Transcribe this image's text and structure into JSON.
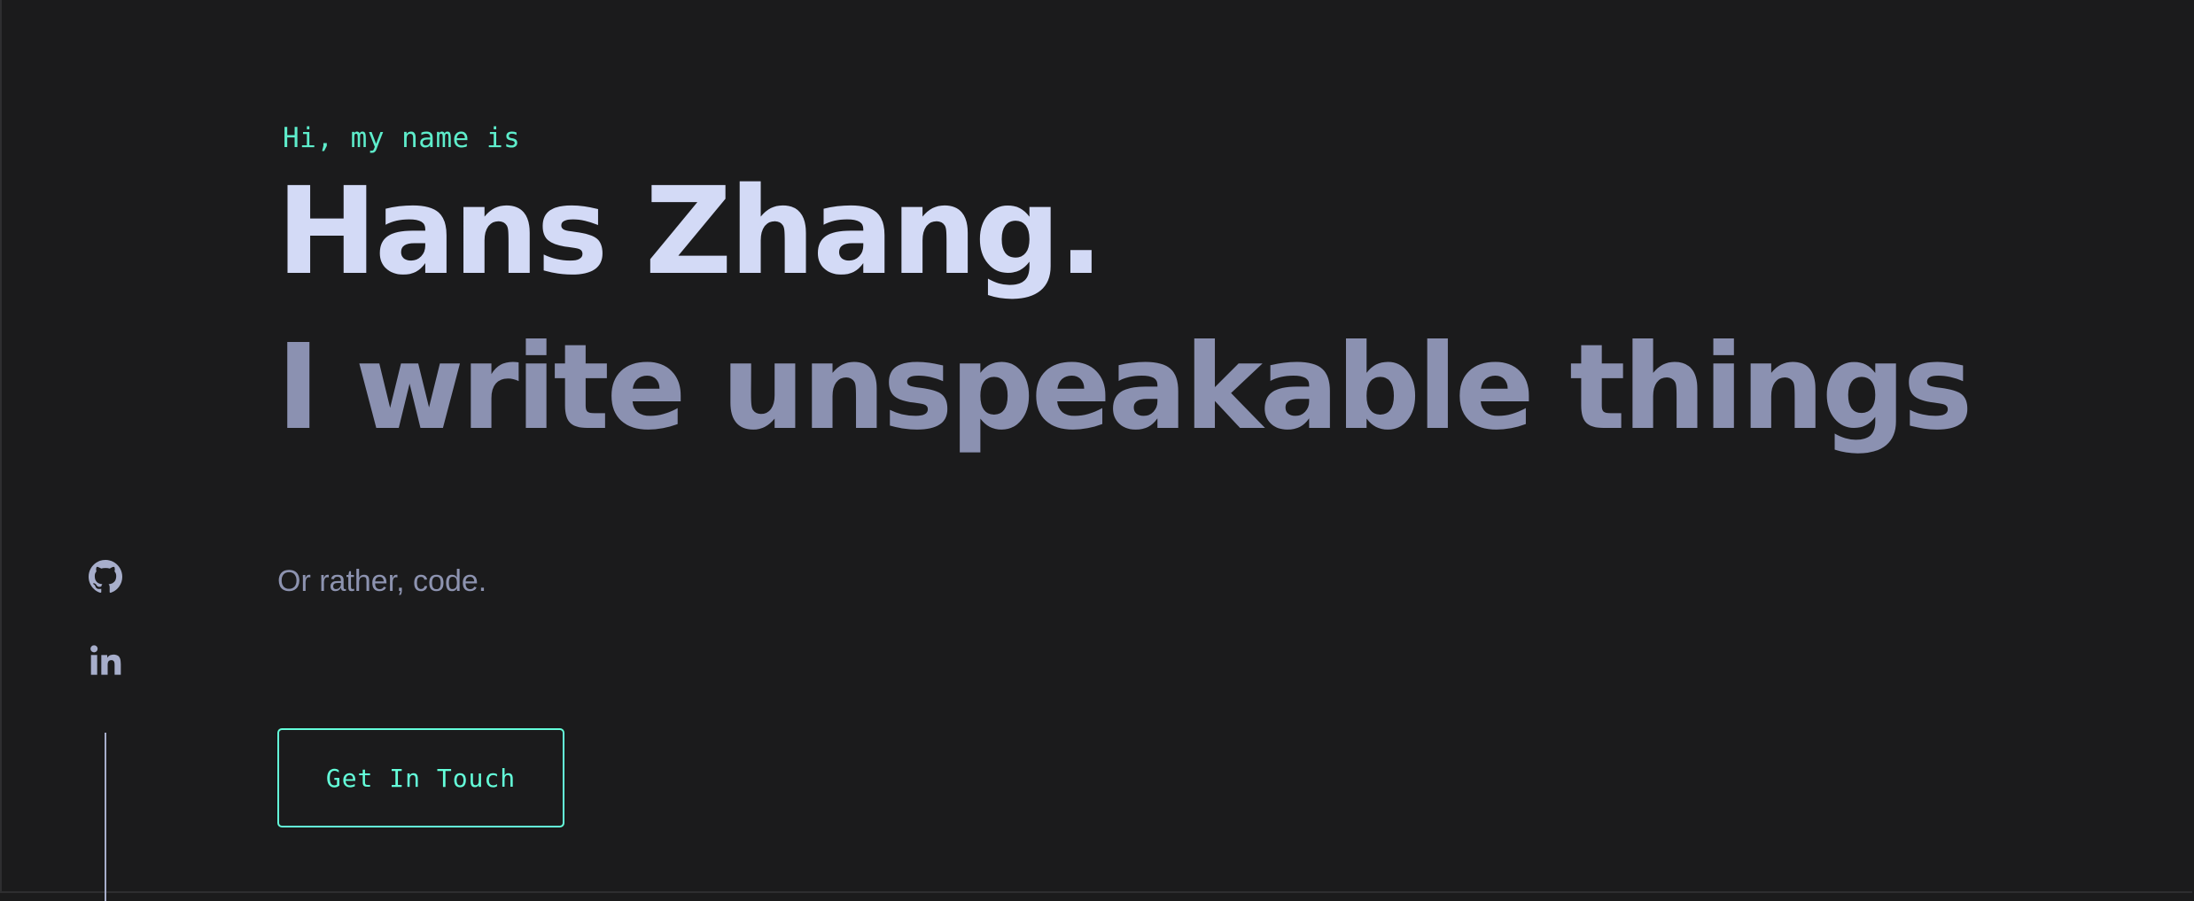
{
  "hero": {
    "greeting": "Hi, my name is",
    "name": "Hans Zhang.",
    "tagline": "I write unspeakable things",
    "subtitle": "Or rather, code.",
    "cta_label": "Get In Touch"
  },
  "social": {
    "items": [
      {
        "icon": "github-icon"
      },
      {
        "icon": "linkedin-icon"
      }
    ]
  },
  "colors": {
    "background": "#1b1b1c",
    "accent": "#64ffda",
    "name": "#d3daf6",
    "tagline": "#8b91b1",
    "muted": "#8d93b0"
  }
}
